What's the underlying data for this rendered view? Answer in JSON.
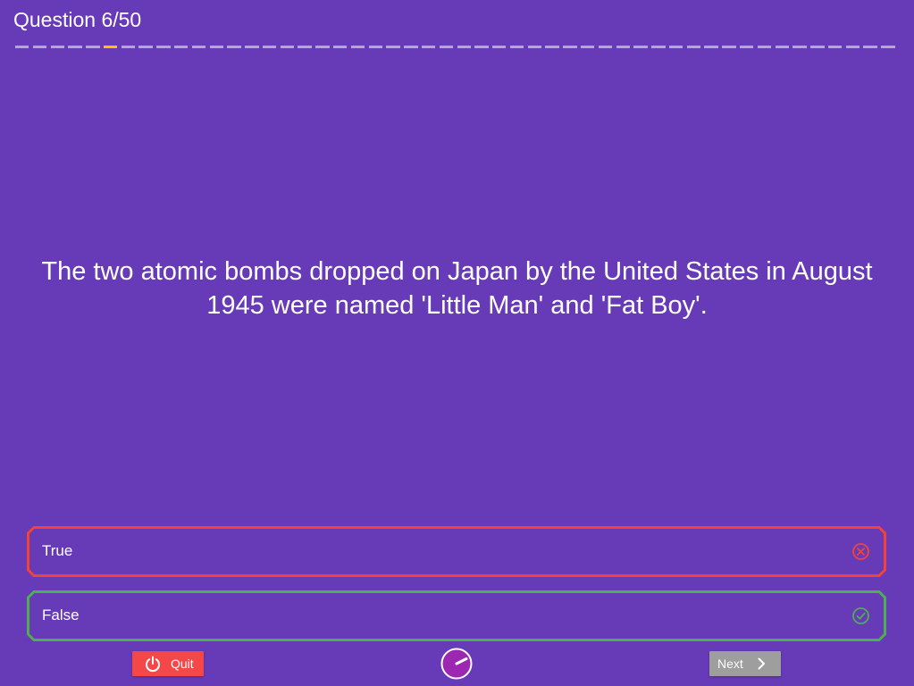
{
  "header": {
    "question_counter": "Question 6/50",
    "current_question": 6,
    "total_questions": 50
  },
  "question": {
    "text": "The two atomic bombs dropped on Japan by the United States in August 1945 were named 'Little Man' and 'Fat Boy'."
  },
  "answers": [
    {
      "label": "True",
      "state": "incorrect",
      "icon": "cross-circle-icon",
      "color": "#f44336"
    },
    {
      "label": "False",
      "state": "correct",
      "icon": "check-circle-icon",
      "color": "#4caf50"
    }
  ],
  "footer": {
    "quit_label": "Quit",
    "quit_icon": "power-icon",
    "timer_icon": "timer-dial-icon",
    "next_label": "Next",
    "next_icon": "chevron-right-icon"
  },
  "colors": {
    "background": "#673ab7",
    "progress_done": "#b4a8c4",
    "progress_current": "#ffc107",
    "quit": "#f44747",
    "next_disabled": "#9e9e9e",
    "timer": "#9c27b0"
  }
}
